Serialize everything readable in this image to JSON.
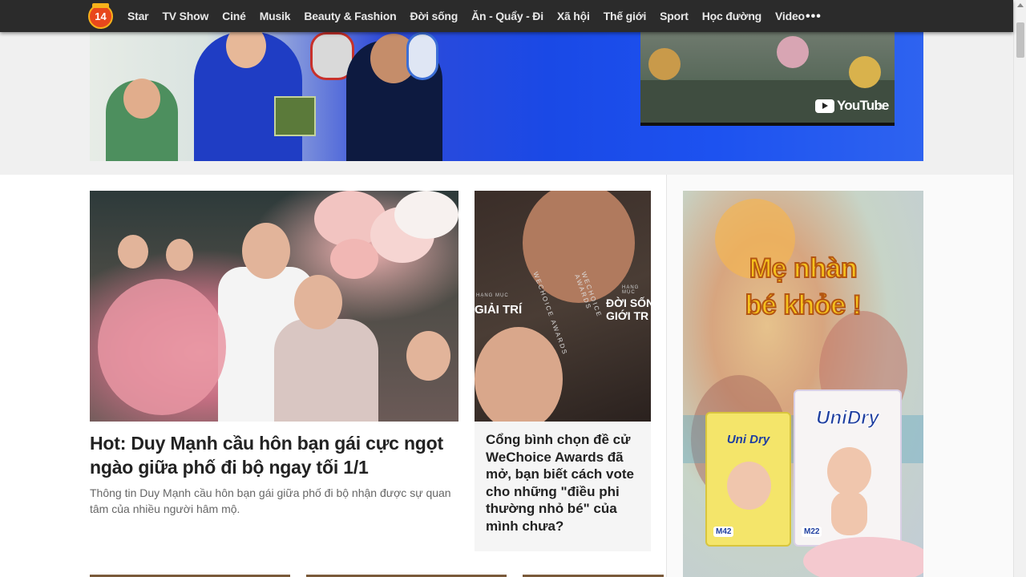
{
  "nav": {
    "logo_text": "14",
    "items": [
      "Star",
      "TV Show",
      "Ciné",
      "Musik",
      "Beauty & Fashion",
      "Đời sống",
      "Ăn - Quẩy - Đi",
      "Xã hội",
      "Thế giới",
      "Sport",
      "Học đường",
      "Video"
    ],
    "more": "•••"
  },
  "banner": {
    "video_brand": "YouTube",
    "close": "×"
  },
  "main_article": {
    "title": "Hot: Duy Mạnh cầu hôn bạn gái cực ngọt ngào giữa phố đi bộ ngay tối 1/1",
    "sapo": "Thông tin Duy Mạnh cầu hôn bạn gái giữa phố đi bộ nhận được sự quan tâm của nhiều người hâm mộ."
  },
  "side_article": {
    "image_text_left": "GIẢI TRÍ",
    "image_text_right_1": "ĐỜI SỐN",
    "image_text_right_2": "GIỚI TR",
    "image_small_left": "HẠNG MỤC",
    "image_small_right": "HẠNG MỤC",
    "image_vertical_1": "WECHOICE AWARDS",
    "image_vertical_2": "WECHOICE AWARDS",
    "title": "Cổng bình chọn đề cử WeChoice Awards đã mở, bạn biết cách vote cho những \"điều phi thường nhỏ bé\" của mình chưa?"
  },
  "ad": {
    "headline_1": "Mẹ nhàn",
    "headline_2": "bé khỏe !",
    "pack1_brand": "Uni Dry",
    "pack1_size": "M42",
    "pack2_brand": "UniDry",
    "pack2_size": "M22"
  },
  "colors": {
    "nav_bg": "#2b2b2b",
    "logo_bg": "#e8481c",
    "ad_headline": "#f6c21c"
  }
}
